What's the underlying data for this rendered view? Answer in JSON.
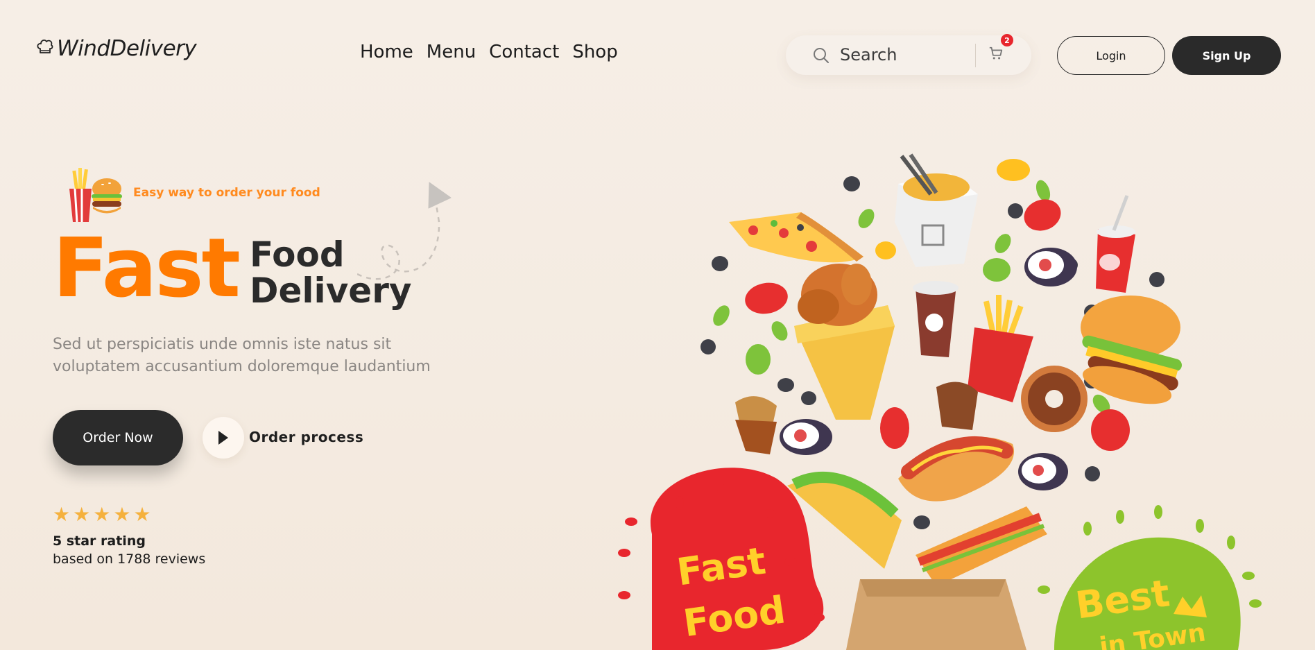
{
  "header": {
    "logo_text": "WindDelivery",
    "logo_icon": "chef-hat-icon",
    "nav": [
      {
        "label": "Home"
      },
      {
        "label": "Menu"
      },
      {
        "label": "Contact"
      },
      {
        "label": "Shop"
      }
    ],
    "search": {
      "placeholder": "Search",
      "icon": "search-icon"
    },
    "cart": {
      "icon": "cart-icon",
      "count": "2"
    },
    "login_label": "Login",
    "signup_label": "Sign Up"
  },
  "hero": {
    "tagline": "Easy way to order your food",
    "headline_accent": "Fast",
    "headline_line1": "Food",
    "headline_line2": "Delivery",
    "description_line1": "Sed ut perspiciatis unde omnis iste natus sit",
    "description_line2": "voluptatem accusantium doloremque laudantium",
    "order_button": "Order Now",
    "process_link": "Order process",
    "rating": {
      "stars": 5,
      "title": "5 star rating",
      "subtitle": "based on 1788 reviews"
    },
    "illustration": {
      "badge_left": "Fast Food",
      "badge_right": "Best in Town"
    }
  },
  "colors": {
    "accent": "#ff7a00",
    "dark": "#2b2b2b",
    "star": "#f5b13d",
    "badge": "#e8262d",
    "background": "#f5ede4"
  }
}
